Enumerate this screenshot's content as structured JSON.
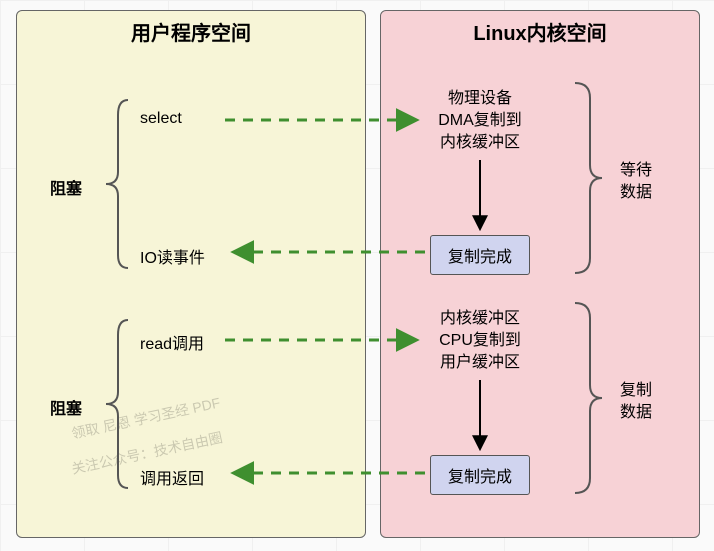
{
  "panels": {
    "left_title": "用户程序空间",
    "right_title": "Linux内核空间"
  },
  "left": {
    "block1_label": "阻塞",
    "block2_label": "阻塞",
    "select_label": "select",
    "io_event_label": "IO读事件",
    "read_call_label": "read调用",
    "return_label": "调用返回"
  },
  "right": {
    "stage1_text": "物理设备\nDMA复制到\n内核缓冲区",
    "stage1_done": "复制完成",
    "stage1_brace_label": "等待\n数据",
    "stage2_text": "内核缓冲区\nCPU复制到\n用户缓冲区",
    "stage2_done": "复制完成",
    "stage2_brace_label": "复制\n数据"
  },
  "watermark": {
    "line1": "领取 尼恩 学习圣经 PDF",
    "line2": "关注公众号：技术自由圈"
  },
  "chart_data": {
    "type": "other",
    "description": "IO multiplexing (select) model — flow diagram between user-space and Linux kernel-space",
    "nodes": [
      {
        "id": "user_panel",
        "label": "用户程序空间",
        "side": "left"
      },
      {
        "id": "kernel_panel",
        "label": "Linux内核空间",
        "side": "right"
      },
      {
        "id": "select",
        "label": "select",
        "side": "left",
        "group": "阻塞1"
      },
      {
        "id": "io_event",
        "label": "IO读事件",
        "side": "left",
        "group": "阻塞1"
      },
      {
        "id": "read_call",
        "label": "read调用",
        "side": "left",
        "group": "阻塞2"
      },
      {
        "id": "return",
        "label": "调用返回",
        "side": "left",
        "group": "阻塞2"
      },
      {
        "id": "stage1_text",
        "label": "物理设备 DMA复制到 内核缓冲区",
        "side": "right",
        "group": "等待数据"
      },
      {
        "id": "stage1_done",
        "label": "复制完成",
        "side": "right",
        "group": "等待数据"
      },
      {
        "id": "stage2_text",
        "label": "内核缓冲区 CPU复制到 用户缓冲区",
        "side": "right",
        "group": "复制数据"
      },
      {
        "id": "stage2_done",
        "label": "复制完成",
        "side": "right",
        "group": "复制数据"
      }
    ],
    "edges": [
      {
        "from": "select",
        "to": "stage1_text",
        "style": "dashed",
        "color": "green"
      },
      {
        "from": "stage1_text",
        "to": "stage1_done",
        "style": "solid",
        "color": "black"
      },
      {
        "from": "stage1_done",
        "to": "io_event",
        "style": "dashed",
        "color": "green"
      },
      {
        "from": "read_call",
        "to": "stage2_text",
        "style": "dashed",
        "color": "green"
      },
      {
        "from": "stage2_text",
        "to": "stage2_done",
        "style": "solid",
        "color": "black"
      },
      {
        "from": "stage2_done",
        "to": "return",
        "style": "dashed",
        "color": "green"
      }
    ],
    "groups": [
      {
        "id": "阻塞1",
        "label": "阻塞",
        "side": "left",
        "members": [
          "select",
          "io_event"
        ]
      },
      {
        "id": "阻塞2",
        "label": "阻塞",
        "side": "left",
        "members": [
          "read_call",
          "return"
        ]
      },
      {
        "id": "等待数据",
        "label": "等待数据",
        "side": "right",
        "members": [
          "stage1_text",
          "stage1_done"
        ]
      },
      {
        "id": "复制数据",
        "label": "复制数据",
        "side": "right",
        "members": [
          "stage2_text",
          "stage2_done"
        ]
      }
    ]
  }
}
